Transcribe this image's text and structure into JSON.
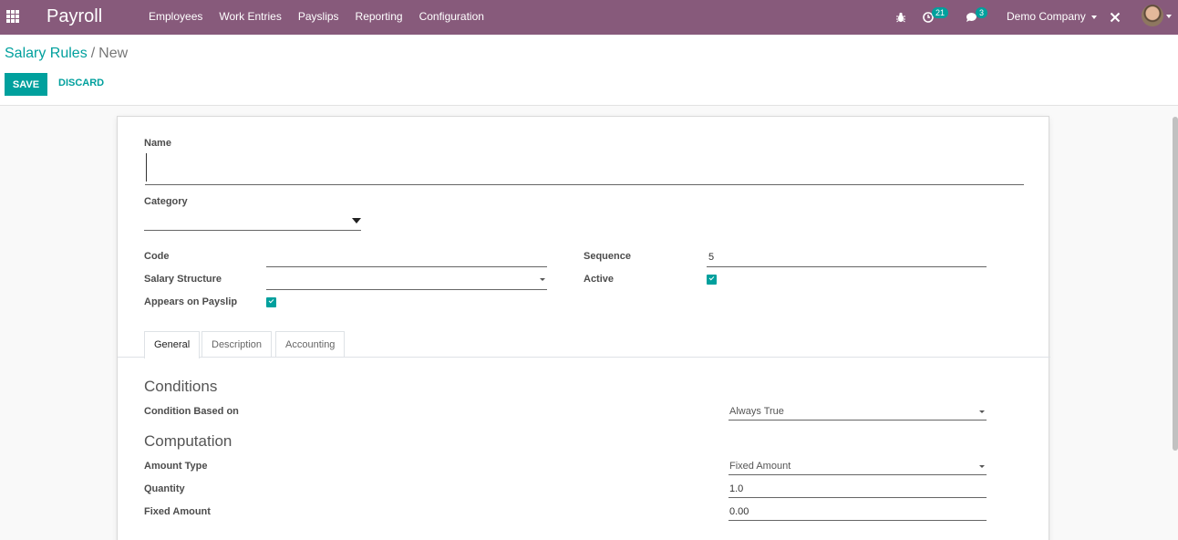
{
  "navbar": {
    "app_title": "Payroll",
    "menu": [
      "Employees",
      "Work Entries",
      "Payslips",
      "Reporting",
      "Configuration"
    ],
    "activity_count": "21",
    "message_count": "3",
    "company": "Demo Company"
  },
  "control": {
    "breadcrumb_parent": "Salary Rules",
    "breadcrumb_separator": "/",
    "breadcrumb_current": "New",
    "save_label": "SAVE",
    "discard_label": "DISCARD"
  },
  "form": {
    "name_label": "Name",
    "name_value": "",
    "category_label": "Category",
    "code_label": "Code",
    "salary_structure_label": "Salary Structure",
    "appears_on_payslip_label": "Appears on Payslip",
    "sequence_label": "Sequence",
    "sequence_value": "5",
    "active_label": "Active",
    "tabs": [
      "General",
      "Description",
      "Accounting"
    ],
    "conditions_heading": "Conditions",
    "condition_based_on_label": "Condition Based on",
    "condition_based_on_value": "Always True",
    "computation_heading": "Computation",
    "amount_type_label": "Amount Type",
    "amount_type_value": "Fixed Amount",
    "quantity_label": "Quantity",
    "quantity_value": "1.0",
    "fixed_amount_label": "Fixed Amount",
    "fixed_amount_value": "0.00"
  },
  "colors": {
    "navbar": "#875a7b",
    "accent": "#00a09d"
  }
}
